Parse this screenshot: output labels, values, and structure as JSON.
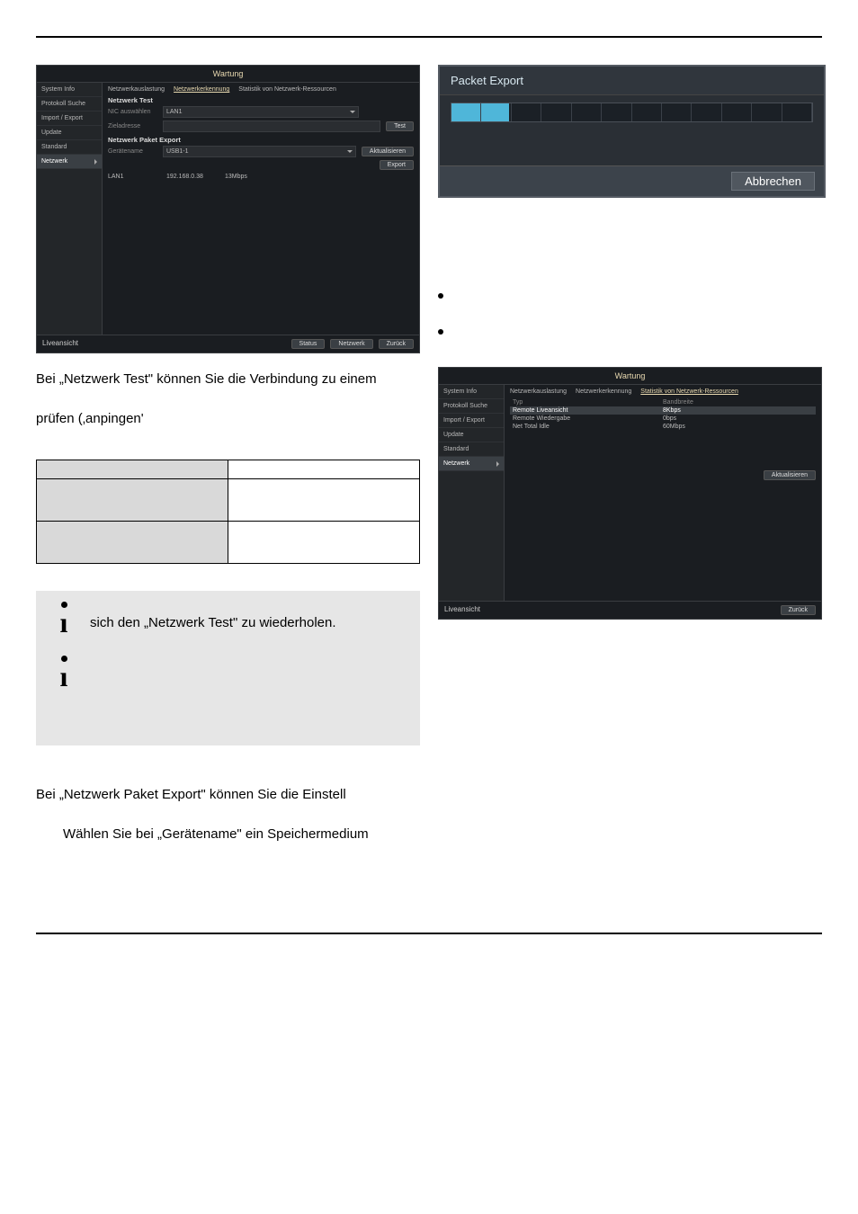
{
  "document": {
    "para1": "Bei „Netzwerk Test\" können Sie die Verbindung zu einem",
    "para2": "prüfen (‚anpingen'",
    "note1_text": "sich den „Netzwerk Test\" zu wiederholen.",
    "para3": "Bei „Netzwerk Paket Export\" können Sie die Einstell",
    "para4": "Wählen Sie bei „Gerätename\" ein Speichermedium"
  },
  "screenshot1": {
    "title": "Wartung",
    "sidebar": [
      "System Info",
      "Protokoll Suche",
      "Import / Export",
      "Update",
      "Standard",
      "Netzwerk"
    ],
    "tabs": [
      "Netzwerkauslastung",
      "Netzwerkerkennung",
      "Statistik von Netzwerk-Ressourcen"
    ],
    "sectionA": "Netzwerk Test",
    "rowA_label": "NIC auswählen",
    "rowA_value": "LAN1",
    "rowB_label": "Zieladresse",
    "btn_test": "Test",
    "sectionB": "Netzwerk Paket Export",
    "rowC_label": "Gerätename",
    "rowC_value": "USB1-1",
    "btn_refresh": "Aktualisieren",
    "btn_export": "Export",
    "tbl": {
      "r1c1": "LAN1",
      "r1c2": "192.168.0.38",
      "r1c3": "13Mbps"
    },
    "footer_left": "Liveansicht",
    "footer_btns": [
      "Status",
      "Netzwerk",
      "Zurück"
    ]
  },
  "screenshot2": {
    "title": "Packet Export",
    "btn_cancel": "Abbrechen"
  },
  "screenshot3": {
    "title": "Wartung",
    "sidebar": [
      "System Info",
      "Protokoll Suche",
      "Import / Export",
      "Update",
      "Standard",
      "Netzwerk"
    ],
    "tabs": [
      "Netzwerkauslastung",
      "Netzwerkerkennung",
      "Statistik von Netzwerk-Ressourcen"
    ],
    "head_c1": "Typ",
    "head_c2": "Bandbreite",
    "rows": [
      {
        "c1": "Remote Liveansicht",
        "c2": "8Kbps"
      },
      {
        "c1": "Remote Wiedergabe",
        "c2": "0bps"
      },
      {
        "c1": "Net Total Idle",
        "c2": "60Mbps"
      }
    ],
    "btn_refresh": "Aktualisieren",
    "footer_left": "Liveansicht",
    "footer_btn": "Zurück"
  }
}
